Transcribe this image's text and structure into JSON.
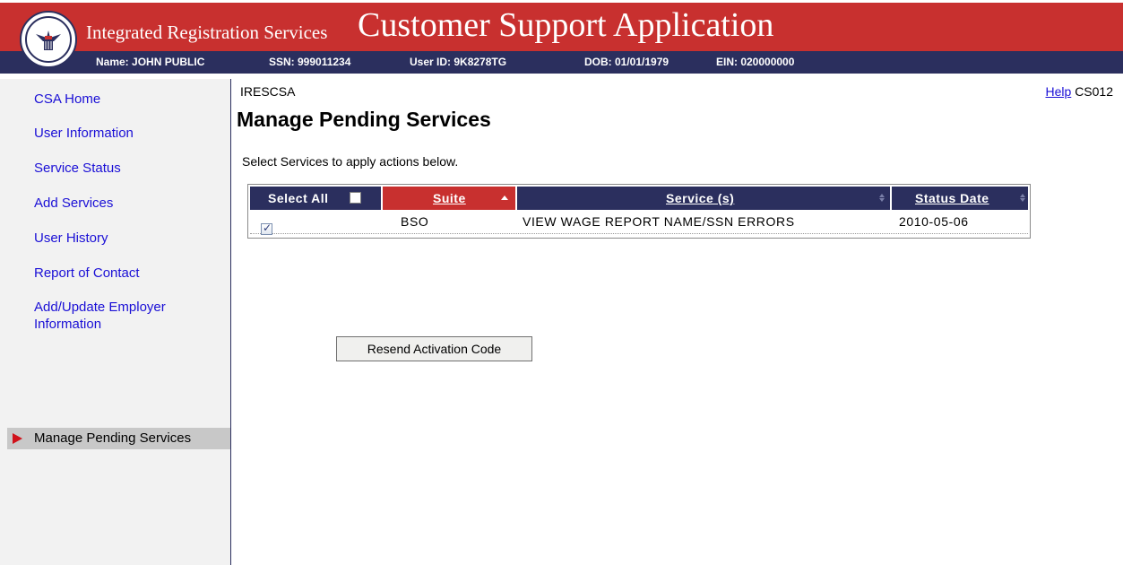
{
  "header": {
    "subtitle": "Integrated Registration Services",
    "title": "Customer Support Application",
    "info": {
      "name": "Name: JOHN PUBLIC",
      "ssn": "SSN: 999011234",
      "user_id": "User ID: 9K8278TG",
      "dob": "DOB: 01/01/1979",
      "ein": "EIN: 020000000"
    },
    "colors": {
      "banner_red": "#c8302f",
      "banner_navy": "#2b2f5e"
    }
  },
  "sidebar": {
    "items": [
      {
        "label": "CSA Home"
      },
      {
        "label": "User Information"
      },
      {
        "label": "Service Status"
      },
      {
        "label": "Add Services"
      },
      {
        "label": "User History"
      },
      {
        "label": "Report of Contact"
      },
      {
        "label": "Add/Update Employer",
        "label2": "Information"
      }
    ],
    "active": {
      "label": "Manage Pending Services",
      "icon": "arrow-right-icon"
    }
  },
  "main": {
    "screen_code": "IRESCSA",
    "help_link": "Help",
    "screen_id": "CS012",
    "title": "Manage Pending Services",
    "instructions": "Select Services to apply actions below.",
    "table": {
      "headers": {
        "select_all": "Select All",
        "suite": "Suite",
        "service": "Service (s)",
        "status_date": "Status Date"
      },
      "rows": [
        {
          "checked": true,
          "suite": "BSO",
          "service": "VIEW WAGE REPORT NAME/SSN ERRORS",
          "status_date": "2010-05-06"
        }
      ]
    },
    "resend_button": "Resend Activation Code"
  }
}
